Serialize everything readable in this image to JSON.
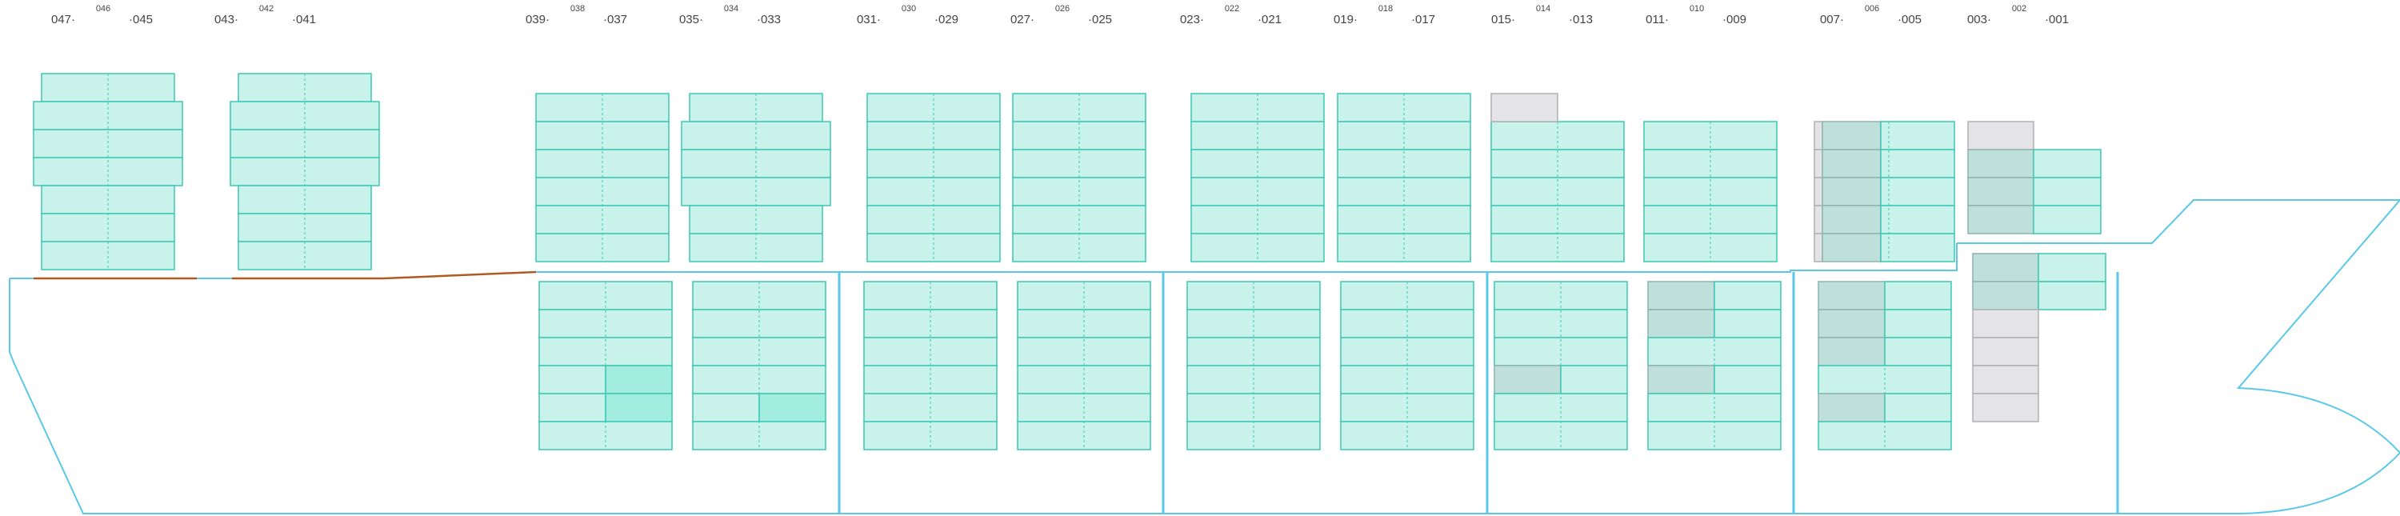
{
  "colors": {
    "cell_fill": "#c8f2ea",
    "cell_stroke": "#3cc8b4",
    "cell_highlight": "#a3ece0",
    "cell_gray": "#bfdfda",
    "cell_gray_stroke": "#8fb3ad",
    "cell_empty": "#e4e4e6",
    "cell_empty_stroke": "#b0b0b4",
    "hull": "#5ac8e8",
    "deck_line": "#b05a22",
    "label_text": "#444444"
  },
  "bays": [
    {
      "id": "047-045",
      "left": "047",
      "mid": "046",
      "right": "045"
    },
    {
      "id": "043-041",
      "left": "043",
      "mid": "042",
      "right": "041"
    },
    {
      "id": "039-037",
      "left": "039",
      "mid": "038",
      "right": "037"
    },
    {
      "id": "035-033",
      "left": "035",
      "mid": "034",
      "right": "033"
    },
    {
      "id": "031-029",
      "left": "031",
      "mid": "030",
      "right": "029"
    },
    {
      "id": "027-025",
      "left": "027",
      "mid": "026",
      "right": "025"
    },
    {
      "id": "023-021",
      "left": "023",
      "mid": "022",
      "right": "021"
    },
    {
      "id": "019-017",
      "left": "019",
      "mid": "018",
      "right": "017"
    },
    {
      "id": "015-013",
      "left": "015",
      "mid": "014",
      "right": "013"
    },
    {
      "id": "011-009",
      "left": "011",
      "mid": "010",
      "right": "009"
    },
    {
      "id": "007-005",
      "left": "007",
      "mid": "006",
      "right": "005"
    },
    {
      "id": "003-001",
      "left": "003",
      "mid": "002",
      "right": "001"
    }
  ]
}
